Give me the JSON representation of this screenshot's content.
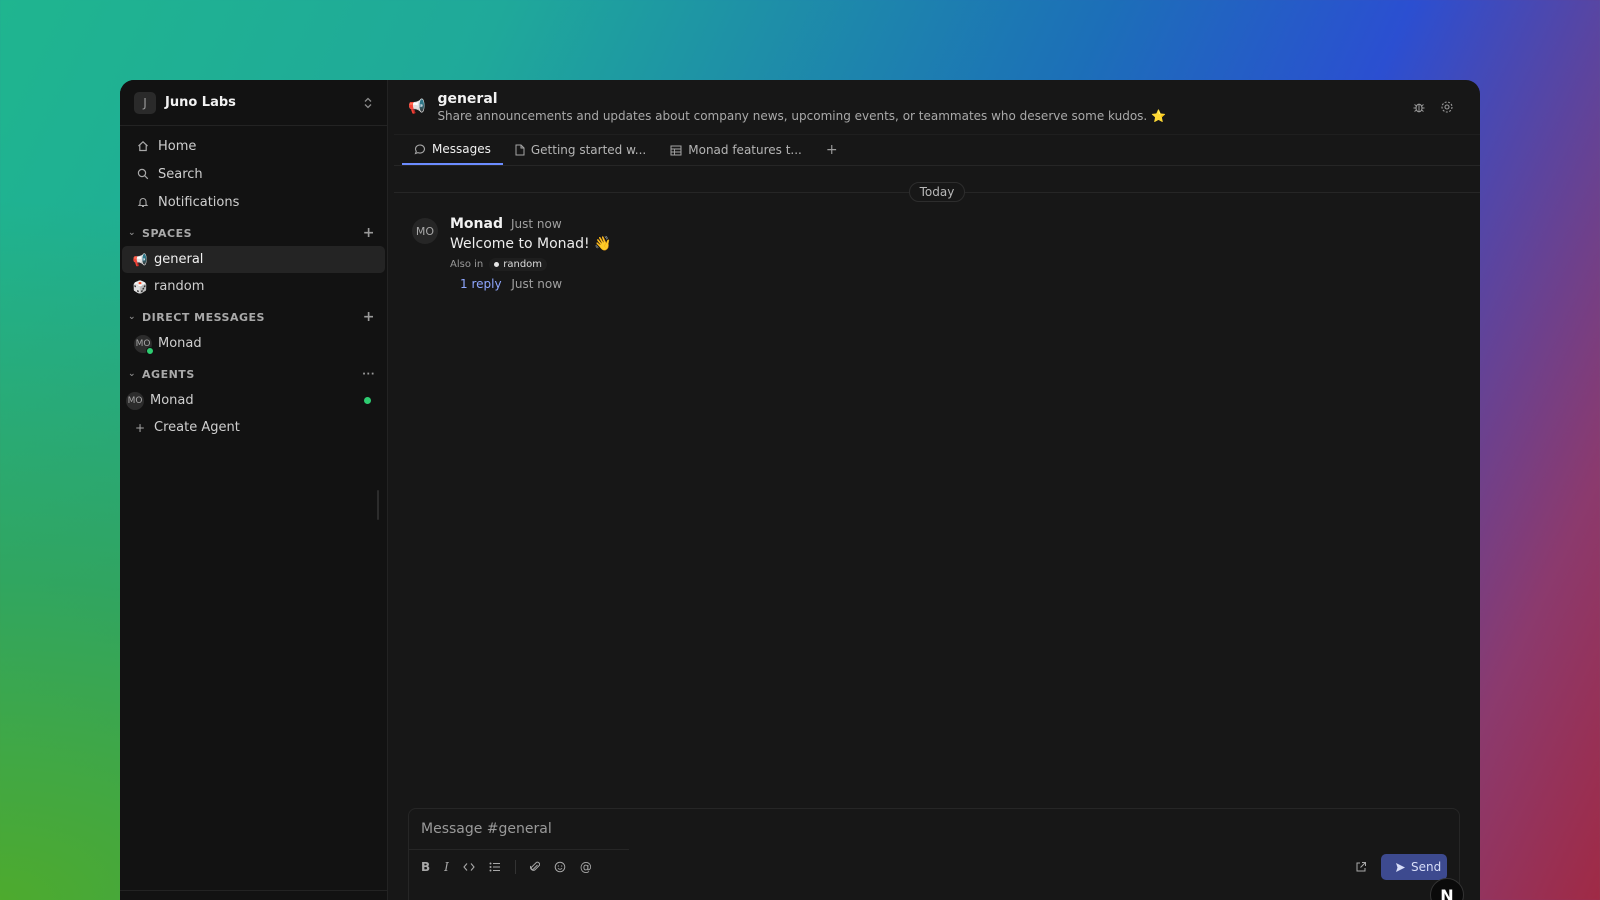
{
  "workspace": {
    "initial": "J",
    "name": "Juno Labs"
  },
  "nav": {
    "home": "Home",
    "search": "Search",
    "notifications": "Notifications"
  },
  "spaces": {
    "title": "SPACES",
    "items": [
      {
        "label": "general",
        "icon": "megaphone-icon",
        "active": true
      },
      {
        "label": "random",
        "icon": "dice-icon",
        "active": false
      }
    ]
  },
  "direct_messages": {
    "title": "DIRECT MESSAGES",
    "items": [
      {
        "avatar": "MO",
        "label": "Monad"
      }
    ]
  },
  "agents": {
    "title": "AGENTS",
    "more": "···",
    "items": [
      {
        "avatar": "MO",
        "label": "Monad"
      }
    ],
    "create": "Create Agent"
  },
  "channel": {
    "name": "general",
    "description": "Share announcements and updates about company news, upcoming events, or teammates who deserve some kudos. ⭐"
  },
  "tabs": [
    {
      "label": "Messages",
      "active": true
    },
    {
      "label": "Getting started w..."
    },
    {
      "label": "Monad features t..."
    }
  ],
  "date_separator": "Today",
  "messages": [
    {
      "avatar": "MO",
      "author": "Monad",
      "time": "Just now",
      "text": "Welcome to Monad! 👋",
      "also_in_label": "Also in",
      "also_in_channel": "random",
      "reply_count": "1 reply",
      "reply_time": "Just now"
    }
  ],
  "composer": {
    "placeholder": "Message #general",
    "send_label": "Send"
  },
  "fab": {
    "label": "N"
  },
  "colors": {
    "accent": "#6c8cff",
    "online": "#2ecc71",
    "send_bg": "#3d4a8f"
  }
}
